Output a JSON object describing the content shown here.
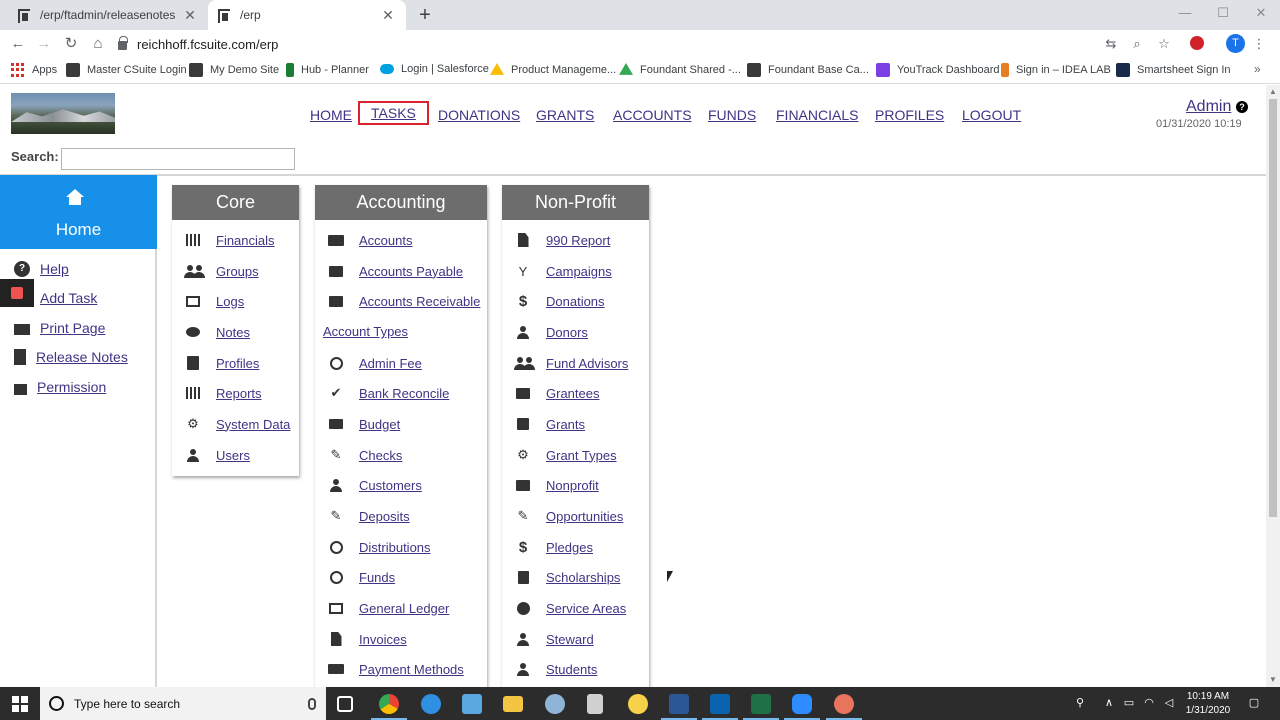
{
  "browser": {
    "tabs": [
      {
        "title": "/erp/ftadmin/releasenotes"
      },
      {
        "title": "/erp"
      }
    ],
    "url": "reichhoff.fcsuite.com/erp",
    "profile_initial": "T",
    "bookmarks": [
      {
        "label": "Apps",
        "icon": "apps-grid-icon"
      },
      {
        "label": "Master CSuite Login",
        "icon": "fcsuite-icon",
        "color": "#3a3a3a"
      },
      {
        "label": "My Demo Site",
        "icon": "fcsuite-icon",
        "color": "#3a3a3a"
      },
      {
        "label": "Hub - Planner",
        "icon": "flag-icon",
        "color": "#1b7d35"
      },
      {
        "label": "Login | Salesforce",
        "icon": "cloud-icon",
        "color": "#00a1e0"
      },
      {
        "label": "Product Manageme...",
        "icon": "drive-icon",
        "color": "#fbbc04"
      },
      {
        "label": "Foundant Shared -...",
        "icon": "drive-icon",
        "color": "#34a853"
      },
      {
        "label": "Foundant Base Ca...",
        "icon": "fcsuite-icon",
        "color": "#3a3a3a"
      },
      {
        "label": "YouTrack Dashboard",
        "icon": "youtrack-icon",
        "color": "#7b3fe4"
      },
      {
        "label": "Sign in – IDEA LAB",
        "icon": "idea-icon",
        "color": "#e67e22"
      },
      {
        "label": "Smartsheet Sign In",
        "icon": "smartsheet-icon",
        "color": "#1a2b4a"
      }
    ]
  },
  "header": {
    "nav": [
      "HOME",
      "TASKS",
      "DONATIONS",
      "GRANTS",
      "ACCOUNTS",
      "FUNDS",
      "FINANCIALS",
      "PROFILES",
      "LOGOUT"
    ],
    "active_nav": "TASKS",
    "user": "Admin",
    "datetime": "01/31/2020 10:19",
    "search_label": "Search:",
    "search_value": ""
  },
  "sidebar": {
    "home_label": "Home",
    "items": [
      {
        "label": "Help",
        "icon": "question-circle-icon"
      },
      {
        "label": "Add Task",
        "icon": "stop-icon"
      },
      {
        "label": "Print Page",
        "icon": "printer-icon"
      },
      {
        "label": "Release Notes",
        "icon": "book-icon"
      },
      {
        "label": "Permission",
        "icon": "lock-icon"
      }
    ]
  },
  "cards": {
    "core": {
      "title": "Core",
      "items": [
        {
          "label": "Financials",
          "icon": "bar-chart-icon"
        },
        {
          "label": "Groups",
          "icon": "group-icon"
        },
        {
          "label": "Logs",
          "icon": "open-book-icon"
        },
        {
          "label": "Notes",
          "icon": "comment-icon"
        },
        {
          "label": "Profiles",
          "icon": "id-card-icon"
        },
        {
          "label": "Reports",
          "icon": "report-icon"
        },
        {
          "label": "System Data",
          "icon": "gears-icon"
        },
        {
          "label": "Users",
          "icon": "user-icon"
        }
      ]
    },
    "accounting": {
      "title": "Accounting",
      "items_top": [
        {
          "label": "Accounts",
          "icon": "folder-open-icon"
        },
        {
          "label": "Accounts Payable",
          "icon": "inbox-icon"
        },
        {
          "label": "Accounts Receivable",
          "icon": "inbox-icon"
        }
      ],
      "section_label": "Account Types",
      "items": [
        {
          "label": "Admin Fee",
          "icon": "coins-icon"
        },
        {
          "label": "Bank Reconcile",
          "icon": "check-icon"
        },
        {
          "label": "Budget",
          "icon": "briefcase-icon"
        },
        {
          "label": "Checks",
          "icon": "pen-icon"
        },
        {
          "label": "Customers",
          "icon": "user-icon"
        },
        {
          "label": "Deposits",
          "icon": "deposit-icon"
        },
        {
          "label": "Distributions",
          "icon": "coins-icon"
        },
        {
          "label": "Funds",
          "icon": "globe-icon"
        },
        {
          "label": "General Ledger",
          "icon": "open-book-icon"
        },
        {
          "label": "Invoices",
          "icon": "file-icon"
        },
        {
          "label": "Payment Methods",
          "icon": "credit-card-icon"
        }
      ]
    },
    "nonprofit": {
      "title": "Non-Profit",
      "items": [
        {
          "label": "990 Report",
          "icon": "list-doc-icon"
        },
        {
          "label": "Campaigns",
          "icon": "glass-icon"
        },
        {
          "label": "Donations",
          "icon": "dollar-icon"
        },
        {
          "label": "Donors",
          "icon": "user-icon"
        },
        {
          "label": "Fund Advisors",
          "icon": "group-icon"
        },
        {
          "label": "Grantees",
          "icon": "store-icon"
        },
        {
          "label": "Grants",
          "icon": "gift-icon"
        },
        {
          "label": "Grant Types",
          "icon": "gear-icon"
        },
        {
          "label": "Nonprofit",
          "icon": "store-icon"
        },
        {
          "label": "Opportunities",
          "icon": "wrench-icon"
        },
        {
          "label": "Pledges",
          "icon": "dollar-icon"
        },
        {
          "label": "Scholarships",
          "icon": "book-icon"
        },
        {
          "label": "Service Areas",
          "icon": "globe-icon"
        },
        {
          "label": "Steward",
          "icon": "user-icon"
        },
        {
          "label": "Students",
          "icon": "user-icon"
        }
      ]
    }
  },
  "taskbar": {
    "search_placeholder": "Type here to search",
    "time": "10:19 AM",
    "date": "1/31/2020",
    "apps": [
      {
        "name": "task-view-icon",
        "color": "#ffffff"
      },
      {
        "name": "chrome-icon",
        "color": "#4285f4"
      },
      {
        "name": "edge-icon",
        "color": "#2f8fe0"
      },
      {
        "name": "tool-icon",
        "color": "#5ba7e0"
      },
      {
        "name": "file-explorer-icon",
        "color": "#f4c542"
      },
      {
        "name": "paint-icon",
        "color": "#8fb4d8"
      },
      {
        "name": "calculator-icon",
        "color": "#d0d0d0"
      },
      {
        "name": "sticky-notes-icon",
        "color": "#f6d24a"
      },
      {
        "name": "word-icon",
        "color": "#2b5797"
      },
      {
        "name": "outlook-icon",
        "color": "#0a64ad"
      },
      {
        "name": "excel-icon",
        "color": "#1e7145"
      },
      {
        "name": "zoom-icon",
        "color": "#2d8cff"
      },
      {
        "name": "app-icon",
        "color": "#e8745b"
      }
    ]
  }
}
